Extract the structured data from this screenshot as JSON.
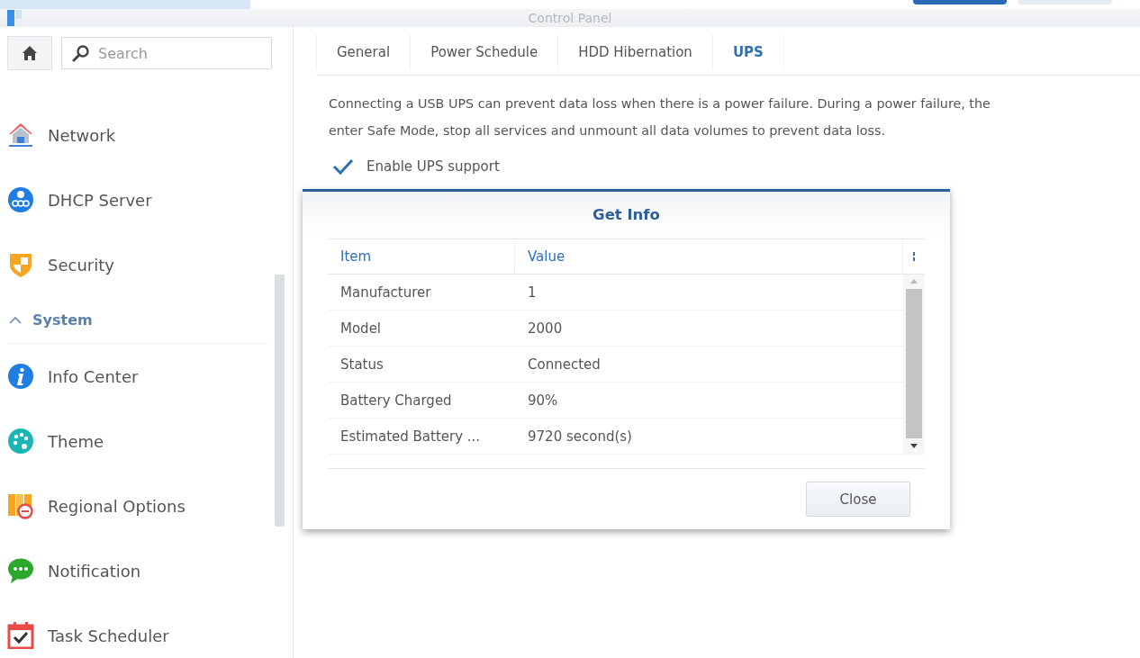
{
  "background_window": {
    "buttons": [
      {
        "kind": "primary"
      },
      {
        "kind": "secondary"
      }
    ]
  },
  "window": {
    "title": "Control Panel"
  },
  "sidebar": {
    "search": {
      "placeholder": "Search"
    },
    "items": [
      {
        "kind": "item",
        "label": "Network"
      },
      {
        "kind": "item",
        "label": "DHCP Server"
      },
      {
        "kind": "item",
        "label": "Security"
      },
      {
        "kind": "header",
        "label": "System",
        "expanded": true
      },
      {
        "kind": "item",
        "label": "Info Center"
      },
      {
        "kind": "item",
        "label": "Theme"
      },
      {
        "kind": "item",
        "label": "Regional Options"
      },
      {
        "kind": "item",
        "label": "Notification"
      },
      {
        "kind": "item",
        "label": "Task Scheduler"
      }
    ]
  },
  "tabs": [
    {
      "label": "General",
      "selected": false
    },
    {
      "label": "Power Schedule",
      "selected": false
    },
    {
      "label": "HDD Hibernation",
      "selected": false
    },
    {
      "label": "UPS",
      "selected": true
    }
  ],
  "description": [
    "Connecting a USB UPS can prevent data loss when there is a power failure. During a power failure, the",
    "enter Safe Mode, stop all services and unmount all data volumes to prevent data loss."
  ],
  "ups_checkbox": {
    "label": "Enable UPS support",
    "checked": true
  },
  "dialog": {
    "title": "Get Info",
    "columns": [
      "Item",
      "Value"
    ],
    "rows": [
      [
        "Manufacturer",
        "1"
      ],
      [
        "Model",
        "2000"
      ],
      [
        "Status",
        "Connected"
      ],
      [
        "Battery Charged",
        "90%"
      ],
      [
        "Estimated Battery ...",
        "9720 second(s)"
      ]
    ],
    "button": "Close"
  }
}
